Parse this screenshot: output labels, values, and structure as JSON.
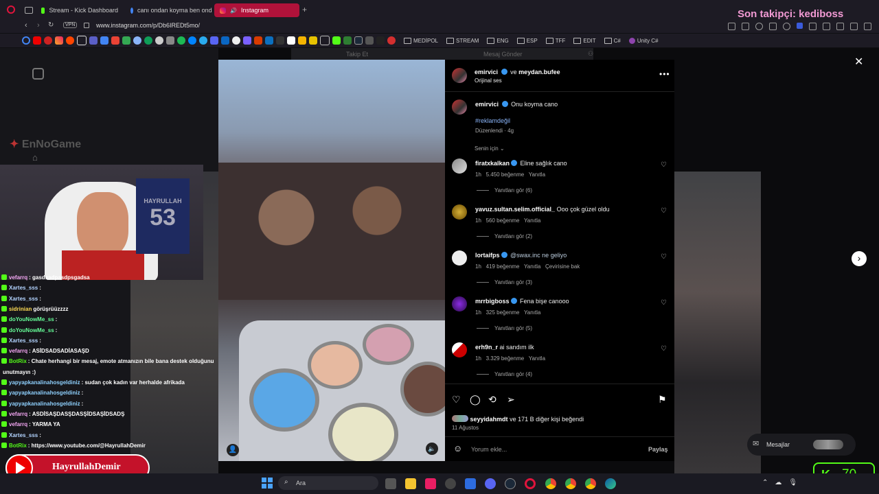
{
  "tabs": [
    {
      "label": "Stream - Kick Dashboard",
      "color": "#53fc18"
    },
    {
      "label": "canı ondan koyma ben ond",
      "color": "#e8eaed"
    },
    {
      "label": "Instagram",
      "color": "#ffffff"
    }
  ],
  "address": {
    "url": "www.instagram.com/p/Db6IREDt5mo/",
    "vpn": "VPN"
  },
  "bookmark_folders": [
    "MEDİPOL",
    "STREAM",
    "ENG",
    "ESP",
    "TFF",
    "EDIT",
    "C#",
    "Unity C#"
  ],
  "overlay_top": "Son takipçi: kediboss",
  "post": {
    "header_user": "emirvici",
    "header_and": "ve",
    "header_collab": "meydan.bufee",
    "audio": "Orijinal ses",
    "caption_user": "emirvici",
    "caption": "Onu koyma cano",
    "hashtag": "#reklamdeğil",
    "edited": "Düzenlendi · 4g",
    "sort": "Senin için",
    "likes_prefix": "seyyidahmdt",
    "likes_rest": "ve 171 B diğer kişi beğendi",
    "date": "11 Ağustos",
    "comment_placeholder": "Yorum ekle...",
    "share": "Paylaş",
    "top_actions": [
      "Takip Et",
      "Mesaj Gönder"
    ]
  },
  "comments": [
    {
      "user": "firatxkalkan",
      "verified": true,
      "text": "Eline sağlık cano",
      "time": "1h",
      "likes": "5.450 beğenme",
      "reply": "Yanıtla",
      "extra": "",
      "view": "Yanıtları gör (6)"
    },
    {
      "user": "yavuz.sultan.selim.official_",
      "verified": false,
      "text": "Ooo çok güzel oldu",
      "time": "1h",
      "likes": "560 beğenme",
      "reply": "Yanıtla",
      "extra": "",
      "view": "Yanıtları gör (2)"
    },
    {
      "user": "lortaifps",
      "verified": true,
      "text": "@swax.inc ne geliyo",
      "time": "1h",
      "likes": "419 beğenme",
      "reply": "Yanıtla",
      "extra": "Çevirisine bak",
      "view": "Yanıtları gör (3)"
    },
    {
      "user": "mrrbigboss",
      "verified": true,
      "text": "Fena bişe canooo",
      "time": "1h",
      "likes": "325 beğenme",
      "reply": "Yanıtla",
      "extra": "",
      "view": "Yanıtları gör (5)"
    },
    {
      "user": "erh9n_r",
      "verified": false,
      "text": "ai sandım ilk",
      "time": "1h",
      "likes": "3.329 beğenme",
      "reply": "Yanıtla",
      "extra": "",
      "view": "Yanıtları gör (4)"
    }
  ],
  "chat": [
    {
      "user": "vefarrq",
      "color": "#f4a7f4",
      "msg": ": gasdsadpasdpsgadsa"
    },
    {
      "user": "Xartes_sss",
      "color": "#b3d4ff",
      "msg": ":"
    },
    {
      "user": "Xartes_sss",
      "color": "#b3d4ff",
      "msg": ":"
    },
    {
      "user": "sidrinian",
      "color": "#ffdd55",
      "msg": "görüşrüüzzzz"
    },
    {
      "user": "doYouNowMe_ss",
      "color": "#66ff99",
      "msg": ":"
    },
    {
      "user": "doYouNowMe_ss",
      "color": "#66ff99",
      "msg": ":"
    },
    {
      "user": "Xartes_sss",
      "color": "#b3d4ff",
      "msg": ":"
    },
    {
      "user": "vefarrq",
      "color": "#f4a7f4",
      "msg": ": ASİDSADSADİASAŞD"
    },
    {
      "user": "BotRix",
      "color": "#53fc18",
      "msg": ": Chate herhangi bir mesaj, emote atmanızın bile bana destek olduğunu"
    },
    {
      "user": "",
      "color": "#ffffff",
      "msg": "unutmayın :)"
    },
    {
      "user": "yapyapkanalinahosgeldiniz",
      "color": "#8fd1ff",
      "msg": ": sudan çok kadın var herhalde afrikada"
    },
    {
      "user": "yapyapkanalinahosgeldiniz",
      "color": "#8fd1ff",
      "msg": ":"
    },
    {
      "user": "yapyapkanalinahosgeldiniz",
      "color": "#8fd1ff",
      "msg": ":"
    },
    {
      "user": "vefarrq",
      "color": "#f4a7f4",
      "msg": ": ASDİSAŞDASŞDASŞİDSAŞİDSADŞ"
    },
    {
      "user": "vefarrq",
      "color": "#f4a7f4",
      "msg": ": YARMA YA"
    },
    {
      "user": "Xartes_sss",
      "color": "#b3d4ff",
      "msg": ":"
    },
    {
      "user": "BotRix",
      "color": "#53fc18",
      "msg": ": https://www.youtube.com/@HayrullahDemir"
    }
  ],
  "webcam_jersey": {
    "name": "HAYRULLAH",
    "number": "53"
  },
  "youtube_badge": "HayrullahDemir",
  "messages_label": "Mesajlar",
  "kick_viewers": "70",
  "taskbar_search": "Ara",
  "watermark": "EnNoGame"
}
